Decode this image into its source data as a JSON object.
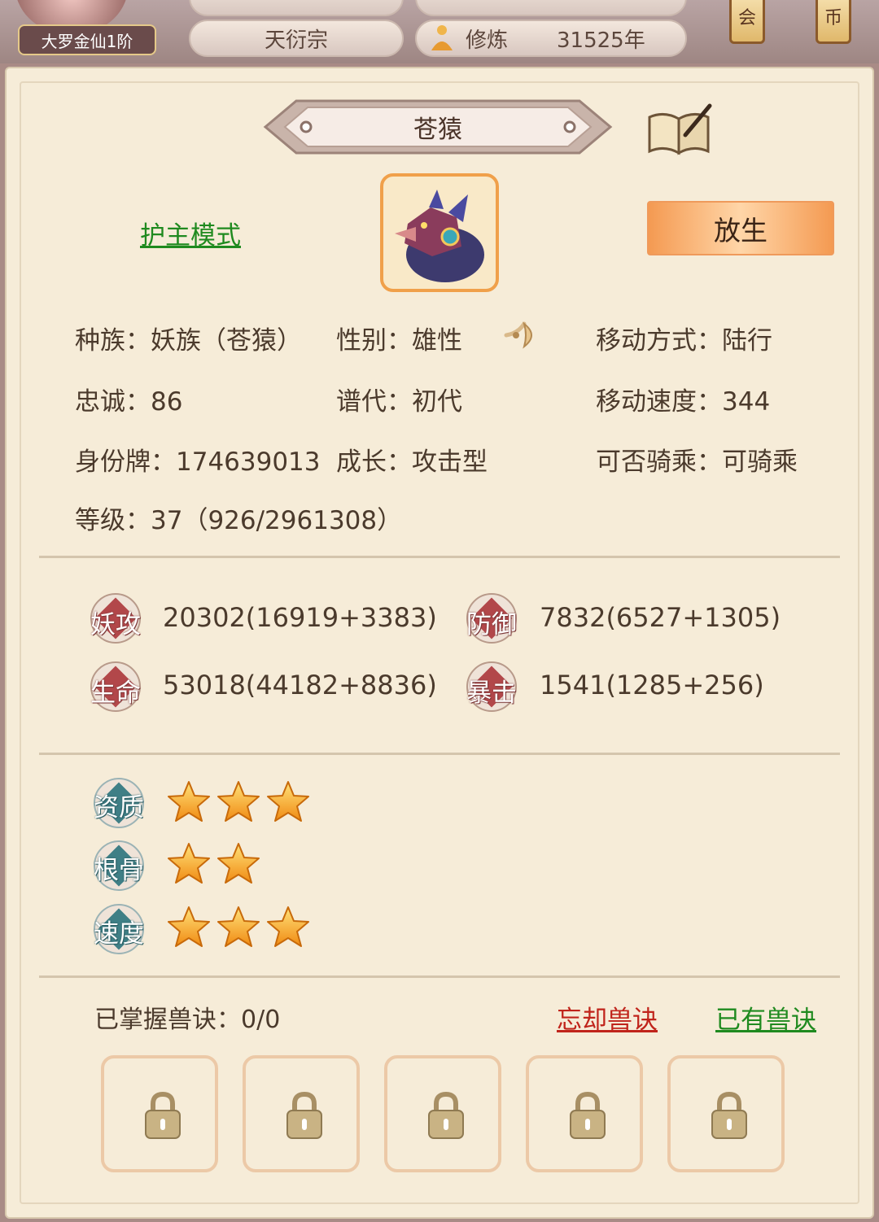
{
  "header": {
    "rank": "大罗金仙1阶",
    "sect": "天衍宗",
    "cultivation_label": "修炼",
    "cultivation_value": "31525年",
    "lantern_left": "会",
    "lantern_right": "币"
  },
  "pet": {
    "name": "苍猿",
    "guard_mode": "护主模式",
    "release_button": "放生",
    "attrs": {
      "race": "种族：妖族（苍猿）",
      "gender": "性别：雄性",
      "move_type": "移动方式：陆行",
      "loyalty": "忠诚：86",
      "generation": "谱代：初代",
      "move_speed": "移动速度：344",
      "id_tag": "身份牌：174639013",
      "growth": "成长：攻击型",
      "rideable": "可否骑乘：可骑乘",
      "level": "等级：37（926/2961308）"
    }
  },
  "stats": {
    "attack_label": "妖攻",
    "attack_value": "20302(16919+3383)",
    "defense_label": "防御",
    "defense_value": "7832(6527+1305)",
    "hp_label": "生命",
    "hp_value": "53018(44182+8836)",
    "crit_label": "暴击",
    "crit_value": "1541(1285+256)"
  },
  "qualities": {
    "aptitude_label": "资质",
    "aptitude_stars": 3,
    "bone_label": "根骨",
    "bone_stars": 2,
    "speed_label": "速度",
    "speed_stars": 3
  },
  "skills": {
    "mastered_label": "已掌握兽诀：0/0",
    "forget_link": "忘却兽诀",
    "owned_link": "已有兽诀",
    "slot_count": 5
  }
}
